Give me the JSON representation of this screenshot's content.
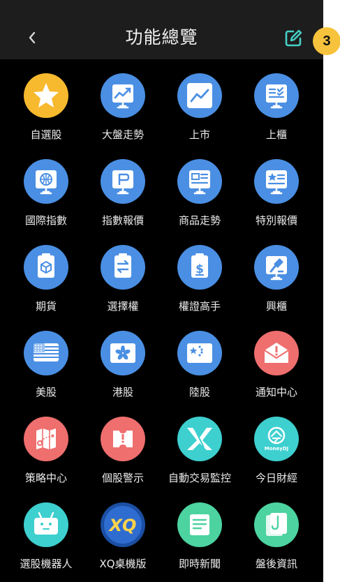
{
  "header": {
    "title": "功能總覽",
    "back_icon": "chevron-left-icon",
    "edit_icon": "edit-icon",
    "badge": "3"
  },
  "colors": {
    "header_bg": "#1d1d1d",
    "page_bg": "#000000",
    "blue": "#4a8fe3",
    "yellow": "#f7b92e",
    "red": "#ef6e6e",
    "teal": "#3ecfcf",
    "green": "#4cd3a0",
    "badge": "#f7c33d",
    "edit_icon": "#46d1c6"
  },
  "features": [
    {
      "label": "自選股",
      "icon": "star-icon"
    },
    {
      "label": "大盤走勢",
      "icon": "market-trend-icon"
    },
    {
      "label": "上市",
      "icon": "line-chart-icon"
    },
    {
      "label": "上櫃",
      "icon": "board-list-icon"
    },
    {
      "label": "國際指數",
      "icon": "globe-icon"
    },
    {
      "label": "指數報價",
      "icon": "flag-icon"
    },
    {
      "label": "商品走勢",
      "icon": "commodity-board-icon"
    },
    {
      "label": "特別報價",
      "icon": "special-quote-icon"
    },
    {
      "label": "期貨",
      "icon": "futures-clipboard-icon"
    },
    {
      "label": "選擇權",
      "icon": "options-clipboard-icon"
    },
    {
      "label": "權證高手",
      "icon": "warrant-clipboard-icon"
    },
    {
      "label": "興櫃",
      "icon": "emerging-board-icon"
    },
    {
      "label": "美股",
      "icon": "us-flag-icon"
    },
    {
      "label": "港股",
      "icon": "hk-flag-icon"
    },
    {
      "label": "陸股",
      "icon": "china-flag-icon"
    },
    {
      "label": "通知中心",
      "icon": "notification-envelope-icon"
    },
    {
      "label": "策略中心",
      "icon": "strategy-map-icon"
    },
    {
      "label": "個股警示",
      "icon": "stock-alert-icon"
    },
    {
      "label": "自動交易監控",
      "icon": "xs-logo-icon"
    },
    {
      "label": "今日財經",
      "icon": "moneydj-logo-icon",
      "icon_text": "MoneyDJ"
    },
    {
      "label": "選股機器人",
      "icon": "robot-icon"
    },
    {
      "label": "XQ桌機版",
      "icon": "xq-logo-icon",
      "icon_text": "XQ"
    },
    {
      "label": "即時新聞",
      "icon": "news-icon"
    },
    {
      "label": "盤後資訊",
      "icon": "after-hours-icon"
    }
  ]
}
